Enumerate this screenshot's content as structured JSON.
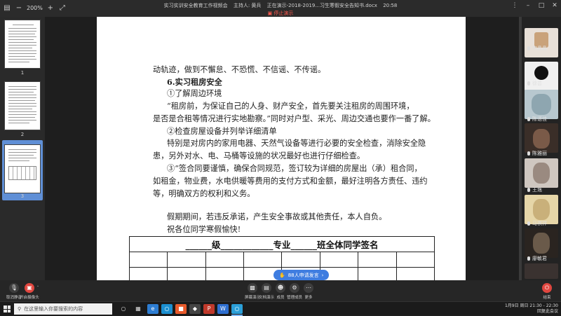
{
  "window": {
    "zoom": "200%",
    "title": "实习实训安全教育工作视频会",
    "host": "主持人: 黄兵",
    "presenting": "正在演示-2018-2019...习生寒假安全告知书.docx",
    "time": "20:58",
    "stop_label": "停止演示"
  },
  "thumbnails": [
    {
      "num": "1",
      "selected": false
    },
    {
      "num": "2",
      "selected": false
    },
    {
      "num": "3",
      "selected": true
    }
  ],
  "document": {
    "lines": [
      "动轨迹，做到不懈怠、不恐慌、不信谣、不传谣。",
      "6.实习租房安全",
      "①了解周边环境",
      "“租房前，为保证自己的人身、财产安全，首先要关注租房的周围环境，",
      "是否是合租等情况进行实地勘察。”同时对户型、采光、周边交通也要作一番了解。",
      "②检查房屋设备并列举详细清单",
      "特别是对房内的家用电器、天然气设备等进行必要的安全检查，消除安全隐",
      "患，另外对水、电、马桶等设施的状况最好也进行仔细检查。",
      "③“签合同要谨慎，确保合同规范，签订较为详细的房屋出（承）租合同，",
      "如租金，物业费，水电供暖等费用的支付方式和金额，最好注明各方责任、违约",
      "等，明确双方的权利和义务。",
      "假期期间，若违反承诺，产生安全事故或其他责任，本人自负。",
      "祝各位同学寒假愉快!"
    ],
    "signature_title": "______级____________专业______班全体同学签名"
  },
  "speak_button": "88人申请发言",
  "participants": [
    {
      "name": "申晶晶",
      "color": "#c9a27a"
    },
    {
      "name": "徐芸",
      "color": "#111111"
    },
    {
      "name": "陈语佳",
      "color": "#8ea6b0"
    },
    {
      "name": "陈雅丽",
      "color": "#7a5a48"
    },
    {
      "name": "王逸",
      "color": "#9a8a80"
    },
    {
      "name": "马祺祥",
      "color": "#c9b07a"
    },
    {
      "name": "廖敏君",
      "color": "#6a5a4a"
    }
  ],
  "toolbar": {
    "mute": "取消静音",
    "video": "开启摄像头",
    "share": "屏幕演示",
    "doc": "文档演示",
    "members": "成员",
    "manage": "管理成员",
    "more": "更多",
    "leave": "结束"
  },
  "taskbar": {
    "search_placeholder": "在这里输入你要搜索的内容",
    "clock_line1": "1月9日 周日 21:30 - 22:30",
    "clock_line2": "回复此会议"
  }
}
